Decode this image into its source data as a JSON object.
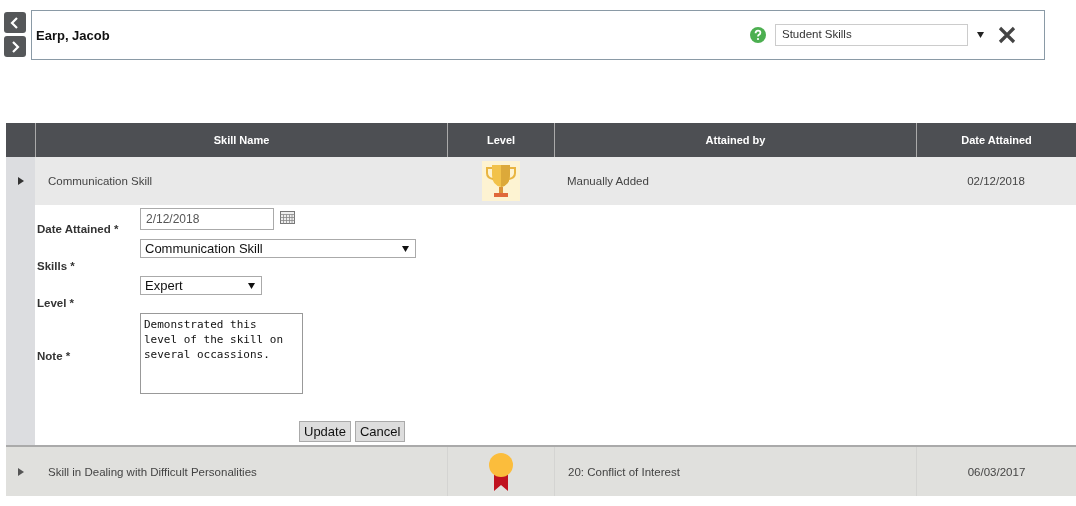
{
  "header": {
    "name": "Earp, Jacob",
    "view_select": {
      "value": "Student Skills"
    }
  },
  "table": {
    "columns": [
      "Skill Name",
      "Level",
      "Attained by",
      "Date Attained"
    ],
    "rows": [
      {
        "skill": "Communication Skill",
        "kind": "trophy",
        "attained_by": "Manually Added",
        "date": "02/12/2018",
        "expanded": true,
        "form": {
          "date_label": "Date Attained *",
          "date_value": "2/12/2018",
          "skills_label": "Skills *",
          "skills_value": "Communication Skill",
          "level_label": "Level *",
          "level_value": "Expert",
          "note_label": "Note *",
          "note_value": "Demonstrated this level of the skill on several occassions.",
          "buttons": [
            "Update",
            "Cancel"
          ]
        }
      },
      {
        "skill": "Skill in Dealing with Difficult Personalities",
        "kind": "medal",
        "attained_by": "20: Conflict of Interest",
        "date": "06/03/2017",
        "expanded": false
      }
    ]
  }
}
